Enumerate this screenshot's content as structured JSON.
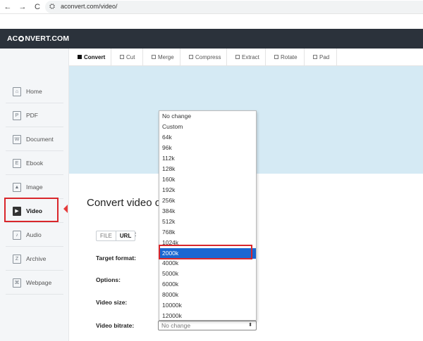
{
  "browser": {
    "url": "aconvert.com/video/",
    "back_icon": "←",
    "forward_icon": "→",
    "reload_icon": "C",
    "site_icon": "⛭"
  },
  "site": {
    "logo_a": "AC",
    "logo_b": "NVERT.COM"
  },
  "sidebar": {
    "items": [
      {
        "label": "Home",
        "icon": "home-icon",
        "glyph": "⌂"
      },
      {
        "label": "PDF",
        "icon": "pdf-icon",
        "glyph": "P"
      },
      {
        "label": "Document",
        "icon": "document-icon",
        "glyph": "W"
      },
      {
        "label": "Ebook",
        "icon": "ebook-icon",
        "glyph": "E"
      },
      {
        "label": "Image",
        "icon": "image-icon",
        "glyph": "▲"
      },
      {
        "label": "Video",
        "icon": "video-icon",
        "glyph": "▶"
      },
      {
        "label": "Audio",
        "icon": "audio-icon",
        "glyph": "♪"
      },
      {
        "label": "Archive",
        "icon": "archive-icon",
        "glyph": "Z"
      },
      {
        "label": "Webpage",
        "icon": "webpage-icon",
        "glyph": "⌘"
      }
    ],
    "active": "Video"
  },
  "tabs": {
    "items": [
      "Convert",
      "Cut",
      "Merge",
      "Compress",
      "Extract",
      "Rotate",
      "Pad"
    ],
    "active": "Convert"
  },
  "main": {
    "title": "Convert video or",
    "source": {
      "file": "FILE",
      "url": "URL",
      "colon": ":"
    },
    "labels": {
      "target_format": "Target format:",
      "options": "Options:",
      "video_size": "Video size:",
      "video_bitrate": "Video bitrate:"
    },
    "bitrate_value": "No change",
    "caret": "⬍"
  },
  "dropdown": {
    "options": [
      "No change",
      "Custom",
      "64k",
      "96k",
      "112k",
      "128k",
      "160k",
      "192k",
      "256k",
      "384k",
      "512k",
      "768k",
      "1024k",
      "2000k",
      "4000k",
      "5000k",
      "6000k",
      "8000k",
      "10000k",
      "12000k"
    ],
    "highlighted": "2000k"
  },
  "colors": {
    "header_bg": "#2b323b",
    "banner_bg": "#d5eaf4",
    "selected_option": "#1a67d2",
    "annotation_red": "#d9262b"
  }
}
